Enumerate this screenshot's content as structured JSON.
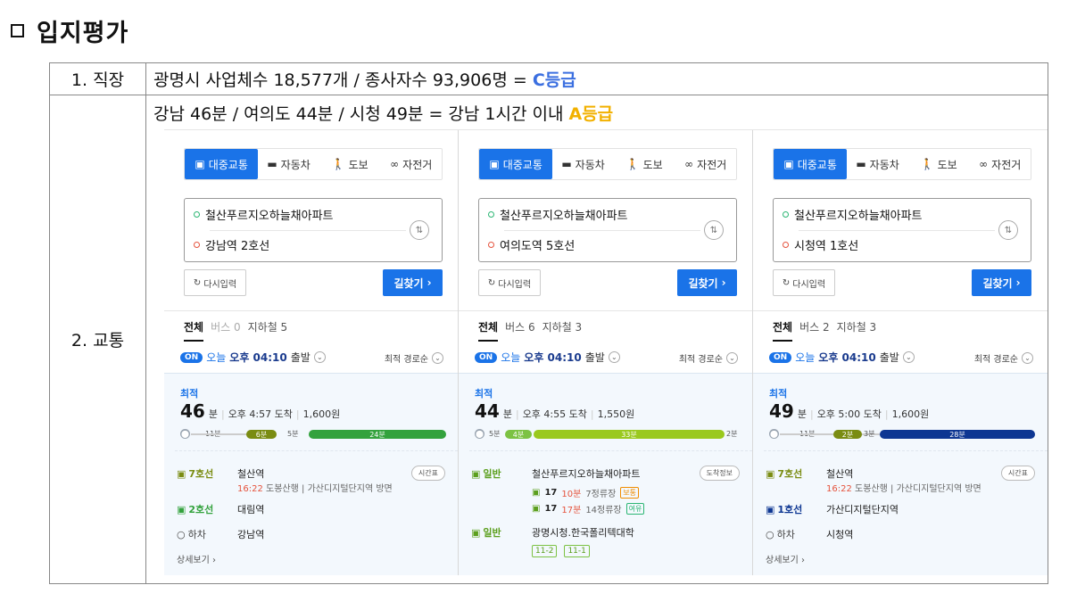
{
  "heading": "입지평가",
  "rows": [
    {
      "label": "1. 직장",
      "text": "광명시 사업체수 18,577개 / 종사자수 93,906명 = ",
      "grade": "C등급"
    },
    {
      "label": "2. 교통",
      "text": "강남 46분 / 여의도 44분 / 시청 49분 = 강남 1시간 이내 ",
      "grade": "A등급"
    }
  ],
  "colors": {
    "accent": "#1a73e8",
    "gradeC": "#3b6fe0",
    "gradeA": "#f2b100",
    "line7": "#7a8c12",
    "line2": "#33a23d",
    "line5": "#8b50a4",
    "line1": "#0d3692",
    "busGreen": "#7cc243"
  },
  "common": {
    "modes": [
      "대중교통",
      "자동차",
      "도보",
      "자전거"
    ],
    "mode_icons": [
      "bus-icon",
      "car-icon",
      "walk-icon",
      "bicycle-icon"
    ],
    "origin": "철산푸르지오하늘채아파트",
    "reset": "다시입력",
    "find": "길찾기",
    "tab_all": "전체",
    "on": "ON",
    "today": "오늘",
    "depart_time": "오후 04:10",
    "depart": "출발",
    "sort": "최적 경로순",
    "best": "최적",
    "minute_unit": "분",
    "detail": "상세보기",
    "timetable": "시간표",
    "stopinfo": "도착정보",
    "alight": "하차"
  },
  "panels": [
    {
      "dest": "강남역 2호선",
      "bus_tab": "버스 0",
      "subway_tab": "지하철 5",
      "minutes": "46",
      "arrive": "오후 4:57 도착",
      "fare": "1,600원",
      "bar": {
        "walk1": "11분",
        "seg1": "6분",
        "walk2": "5분",
        "seg2": "24분"
      },
      "steps": [
        {
          "who": "7호선",
          "where": "철산역",
          "sub_time": "16:22",
          "sub_dir": "도봉산행",
          "sub_to": "가산디지털단지역 방면"
        },
        {
          "who": "2호선",
          "where": "대림역"
        },
        {
          "who": "하차",
          "where": "강남역"
        }
      ]
    },
    {
      "dest": "여의도역 5호선",
      "bus_tab": "버스 6",
      "subway_tab": "지하철 3",
      "minutes": "44",
      "arrive": "오후 4:55 도착",
      "fare": "1,550원",
      "bar": {
        "walk1": "5분",
        "seg1": "4분",
        "walk2": "",
        "seg2": "33분",
        "tail": "2분"
      },
      "steps": [
        {
          "who": "일반",
          "where": "철산푸르지오하늘채아파트"
        },
        {
          "bus": "17",
          "m": "10분",
          "stop": "7정류장",
          "tag": "보통"
        },
        {
          "bus": "17",
          "m": "17분",
          "stop": "14정류장",
          "tag": "여유"
        },
        {
          "who": "일반",
          "where": "광명시청.한국폴리텍대학"
        },
        {
          "chips": [
            "11-2",
            "11-1"
          ]
        }
      ]
    },
    {
      "dest": "시청역 1호선",
      "bus_tab": "버스 2",
      "subway_tab": "지하철 3",
      "minutes": "49",
      "arrive": "오후 5:00 도착",
      "fare": "1,600원",
      "bar": {
        "walk1": "11분",
        "seg1": "2분",
        "walk2": "3분",
        "seg2": "28분"
      },
      "steps": [
        {
          "who": "7호선",
          "where": "철산역",
          "sub_time": "16:22",
          "sub_dir": "도봉산행",
          "sub_to": "가산디지털단지역 방면"
        },
        {
          "who": "1호선",
          "where": "가산디지털단지역"
        },
        {
          "who": "하차",
          "where": "시청역"
        }
      ]
    }
  ]
}
